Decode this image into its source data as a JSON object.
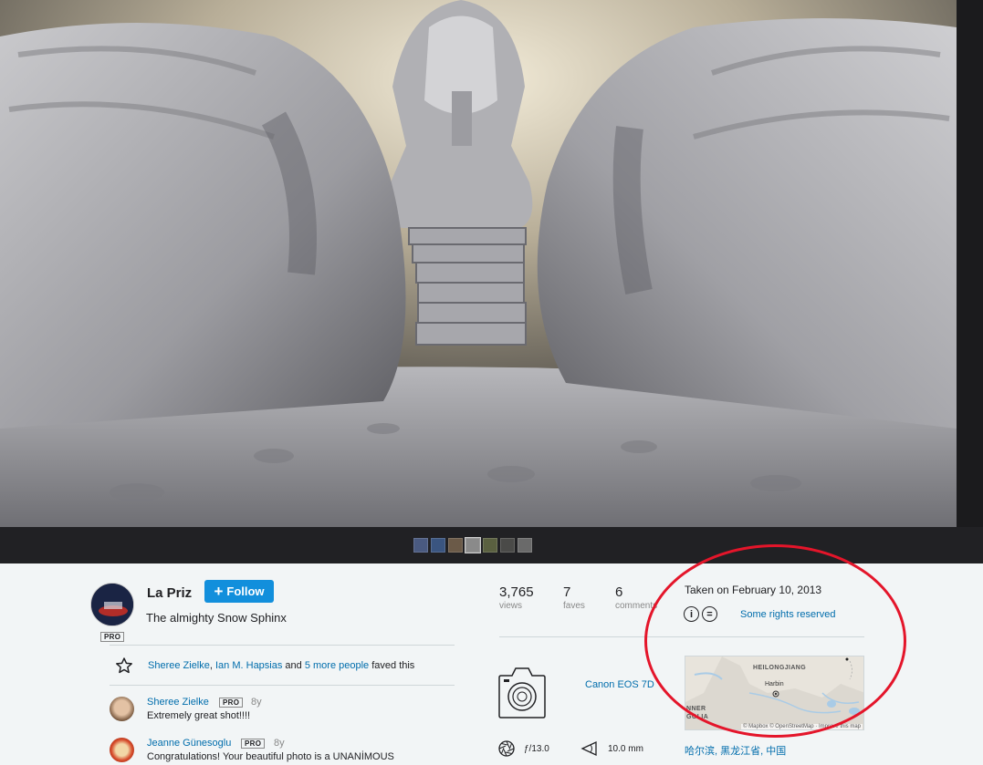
{
  "author": {
    "name": "La Priz",
    "pro_badge": "PRO",
    "follow_label": "Follow"
  },
  "photo": {
    "title": "The almighty Snow Sphinx"
  },
  "filmstrip": {
    "count": 7,
    "active_index": 3,
    "colors": [
      "#4a5a80",
      "#3a5580",
      "#6b5a48",
      "#8a8a8a",
      "#5a6040",
      "#4a4a48",
      "#6a6a6a"
    ]
  },
  "faves": {
    "user1": "Sheree Zielke",
    "separator1": ", ",
    "user2": "Ian M. Hapsias",
    "and": " and ",
    "more": "5 more people",
    "suffix": " faved this"
  },
  "comments": [
    {
      "name": "Sheree Zielke",
      "badge": "PRO",
      "age": "8y",
      "text": "Extremely great shot!!!!"
    },
    {
      "name": "Jeanne Günesoglu",
      "badge": "PRO",
      "age": "8y",
      "text": "Congratulations! Your beautiful photo is a UNANİMOUS"
    }
  ],
  "stats": {
    "views_num": "3,765",
    "views_label": "views",
    "faves_num": "7",
    "faves_label": "faves",
    "comments_num": "6",
    "comments_label": "comments"
  },
  "camera": {
    "model": "Canon EOS 7D",
    "aperture": "ƒ/13.0",
    "focal_length": "10.0 mm"
  },
  "taken": "Taken on February 10, 2013",
  "license": {
    "icon1": "i",
    "icon2": "=",
    "label": "Some rights reserved"
  },
  "map": {
    "region1": "HEILONGJIANG",
    "city": "Harbin",
    "region2_line1": "NNER",
    "region2_line2": "GOLIA",
    "attribution": "© Mapbox © OpenStreetMap · Improve this map"
  },
  "location": "哈尔滨, 黑龙江省, 中国",
  "colors": {
    "accent": "#128fdc",
    "link": "#006dac",
    "annotation": "#e4152a"
  }
}
